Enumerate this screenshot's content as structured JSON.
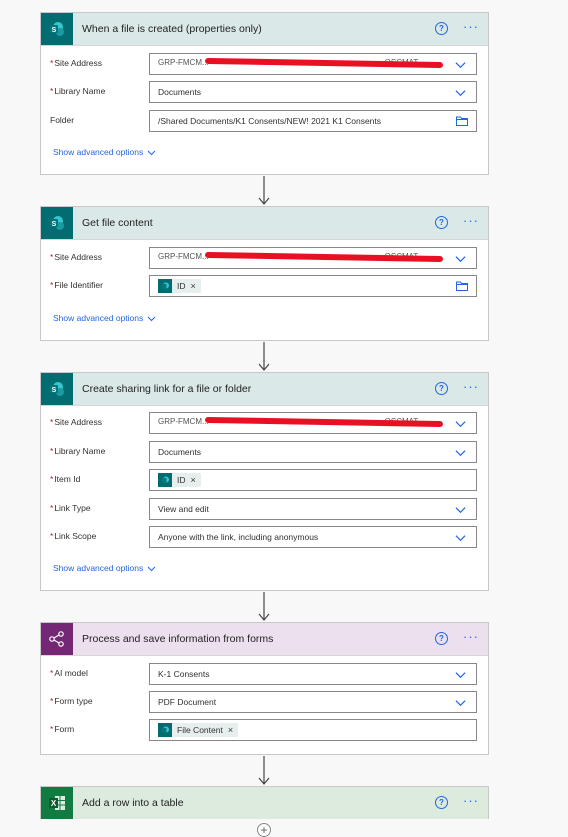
{
  "cards": {
    "c1": {
      "title": "When a file is created (properties only)",
      "site_label": "Site Address",
      "site_visible_prefix": "GRP-FMCM...",
      "site_visible_suffix": "...OSCMAT...",
      "library_label": "Library Name",
      "library_value": "Documents",
      "folder_label": "Folder",
      "folder_value": "/Shared Documents/K1 Consents/NEW! 2021 K1 Consents",
      "advanced": "Show advanced options"
    },
    "c2": {
      "title": "Get file content",
      "site_label": "Site Address",
      "site_visible_prefix": "GRP-FMCM...",
      "site_visible_suffix": "...OSCMAT...",
      "file_label": "File Identifier",
      "file_token": "ID",
      "advanced": "Show advanced options"
    },
    "c3": {
      "title": "Create sharing link for a file or folder",
      "site_label": "Site Address",
      "site_visible_prefix": "GRP-FMCM...",
      "site_visible_suffix": "...OSCMAT...",
      "library_label": "Library Name",
      "library_value": "Documents",
      "item_label": "Item Id",
      "item_token": "ID",
      "linktype_label": "Link Type",
      "linktype_value": "View and edit",
      "linkscope_label": "Link Scope",
      "linkscope_value": "Anyone with the link, including anonymous",
      "advanced": "Show advanced options"
    },
    "c4": {
      "title": "Process and save information from forms",
      "model_label": "AI model",
      "model_value": "K-1 Consents",
      "formtype_label": "Form type",
      "formtype_value": "PDF Document",
      "form_label": "Form",
      "form_token": "File Content"
    },
    "c5": {
      "title": "Add a row into a table"
    }
  },
  "common": {
    "required_mark": "*",
    "help": "?",
    "more": "···",
    "token_remove": "×",
    "add_step": "+"
  },
  "colors": {
    "sharepoint": "#036c70",
    "ai_builder": "#742774",
    "excel": "#107c41",
    "link": "#2266e3",
    "redaction": "#e81123"
  }
}
